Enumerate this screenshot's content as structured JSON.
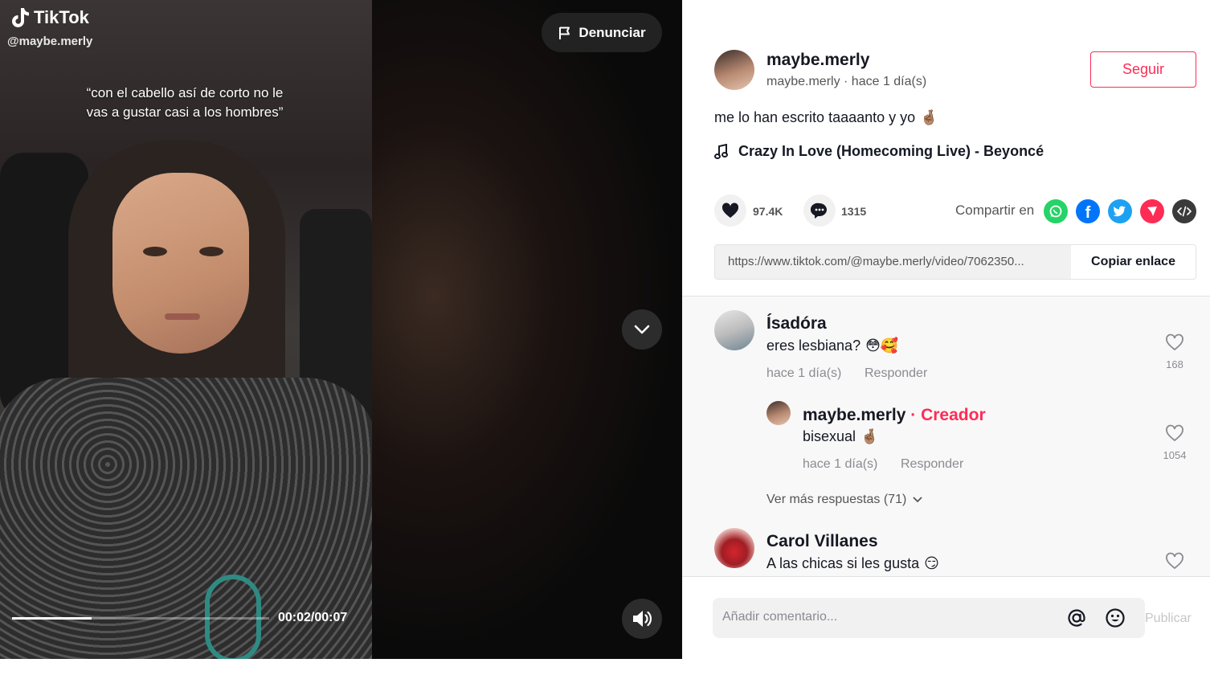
{
  "brand": {
    "name": "TikTok"
  },
  "video": {
    "username": "@maybe.merly",
    "caption": "“con el cabello así de corto no le vas a gustar casi a los hombres”",
    "report_label": "Denunciar",
    "time": "00:02/00:07",
    "progress_fraction": 0.31
  },
  "author": {
    "name": "maybe.merly",
    "meta": "maybe.merly · hace 1 día(s)",
    "follow_label": "Seguir"
  },
  "description": {
    "text": "me lo han escrito taaaanto y yo",
    "emoji": "🤞🏽"
  },
  "music": {
    "title": "Crazy In Love (Homecoming Live) - Beyoncé"
  },
  "stats": {
    "likes": "97.4K",
    "comments": "1315"
  },
  "share": {
    "label": "Compartir en",
    "icons": [
      "whatsapp-icon",
      "facebook-icon",
      "twitter-icon",
      "send-icon",
      "embed-icon"
    ],
    "colors": {
      "whatsapp": "#25D366",
      "facebook": "#0075FA",
      "twitter": "#1DA1F2",
      "send": "#FE2C55",
      "embed": "#3A3A3A"
    }
  },
  "link": {
    "url": "https://www.tiktok.com/@maybe.merly/video/7062350...",
    "copy_label": "Copiar enlace"
  },
  "comments": [
    {
      "name": "Ísadóra",
      "text": "eres lesbiana?",
      "emoji": "😳🥰",
      "time": "hace 1 día(s)",
      "reply_label": "Responder",
      "likes": "168",
      "reply": {
        "name": "maybe.merly",
        "tag": "· Creador",
        "text": "bisexual",
        "emoji": "🤞🏽",
        "time": "hace 1 día(s)",
        "reply_label": "Responder",
        "likes": "1054"
      },
      "more_replies": "Ver más respuestas (71)"
    },
    {
      "name": "Carol Villanes",
      "text": "A las chicas si les gusta",
      "emoji": "😏"
    }
  ],
  "comment_input": {
    "placeholder": "Añadir comentario...",
    "publish_label": "Publicar"
  },
  "colors": {
    "accent": "#FE2C55",
    "text": "#161823",
    "muted": "#8A8B91"
  }
}
